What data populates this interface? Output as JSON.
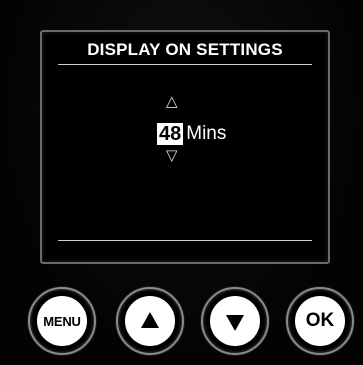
{
  "screen": {
    "title": "DISPLAY ON SETTINGS",
    "value": "48",
    "unit": "Mins",
    "up_arrow_glyph": "△",
    "down_arrow_glyph": "▽"
  },
  "buttons": {
    "menu_label": "MENU",
    "up_icon": "up-triangle-icon",
    "down_icon": "down-triangle-icon",
    "ok_label": "OK"
  },
  "colors": {
    "background": "#050505",
    "screen_border": "#6a6a6a",
    "highlight": "#ffffff"
  }
}
